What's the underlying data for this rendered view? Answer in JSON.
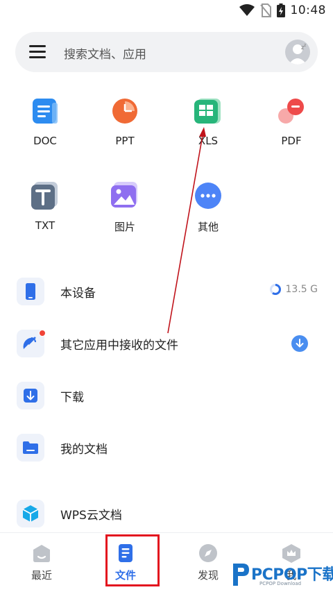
{
  "status_bar": {
    "time": "10:48"
  },
  "search": {
    "placeholder": "搜索文档、应用"
  },
  "file_types": [
    {
      "label": "DOC",
      "icon": "doc-icon",
      "color": "#2d8cf0"
    },
    {
      "label": "PPT",
      "icon": "ppt-icon",
      "color": "#f06a35"
    },
    {
      "label": "XLS",
      "icon": "xls-icon",
      "color": "#27b57a"
    },
    {
      "label": "PDF",
      "icon": "pdf-icon",
      "color": "#ee4a4a"
    },
    {
      "label": "TXT",
      "icon": "txt-icon",
      "color": "#5d6f86"
    },
    {
      "label": "图片",
      "icon": "image-icon",
      "color": "#8f6ff0"
    },
    {
      "label": "其他",
      "icon": "more-icon",
      "color": "#4d84f7"
    }
  ],
  "locations": [
    {
      "label": "本设备",
      "icon": "phone-icon",
      "right_text": "13.5 G",
      "storage_used_fraction": 0.6
    },
    {
      "label": "其它应用中接收的文件",
      "icon": "satellite-icon",
      "badge": true
    },
    {
      "label": "下载",
      "icon": "download-icon"
    },
    {
      "label": "我的文档",
      "icon": "folder-icon"
    },
    {
      "label": "WPS云文档",
      "icon": "cloud-cube-icon"
    }
  ],
  "bottom_nav": [
    {
      "label": "最近",
      "icon": "recent-icon",
      "active": false
    },
    {
      "label": "文件",
      "icon": "file-icon",
      "active": true
    },
    {
      "label": "发现",
      "icon": "compass-icon",
      "active": false
    },
    {
      "label": "我",
      "icon": "crown-icon",
      "active": false
    }
  ],
  "watermark": {
    "brand": "PCPOP下载",
    "sub": "PCPOP Download"
  },
  "colors": {
    "accent": "#2f6fe8",
    "annotation": "#e3131e",
    "arrow": "#c0131b"
  }
}
